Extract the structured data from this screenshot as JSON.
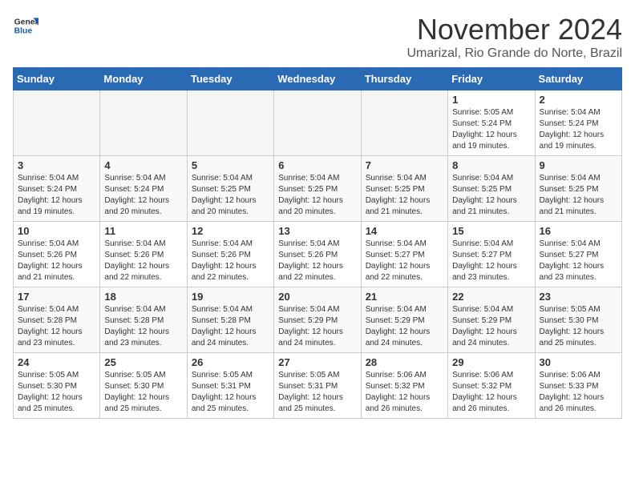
{
  "logo": {
    "line1": "General",
    "line2": "Blue"
  },
  "title": "November 2024",
  "location": "Umarizal, Rio Grande do Norte, Brazil",
  "weekdays": [
    "Sunday",
    "Monday",
    "Tuesday",
    "Wednesday",
    "Thursday",
    "Friday",
    "Saturday"
  ],
  "weeks": [
    [
      {
        "day": "",
        "info": ""
      },
      {
        "day": "",
        "info": ""
      },
      {
        "day": "",
        "info": ""
      },
      {
        "day": "",
        "info": ""
      },
      {
        "day": "",
        "info": ""
      },
      {
        "day": "1",
        "info": "Sunrise: 5:05 AM\nSunset: 5:24 PM\nDaylight: 12 hours and 19 minutes."
      },
      {
        "day": "2",
        "info": "Sunrise: 5:04 AM\nSunset: 5:24 PM\nDaylight: 12 hours and 19 minutes."
      }
    ],
    [
      {
        "day": "3",
        "info": "Sunrise: 5:04 AM\nSunset: 5:24 PM\nDaylight: 12 hours and 19 minutes."
      },
      {
        "day": "4",
        "info": "Sunrise: 5:04 AM\nSunset: 5:24 PM\nDaylight: 12 hours and 20 minutes."
      },
      {
        "day": "5",
        "info": "Sunrise: 5:04 AM\nSunset: 5:25 PM\nDaylight: 12 hours and 20 minutes."
      },
      {
        "day": "6",
        "info": "Sunrise: 5:04 AM\nSunset: 5:25 PM\nDaylight: 12 hours and 20 minutes."
      },
      {
        "day": "7",
        "info": "Sunrise: 5:04 AM\nSunset: 5:25 PM\nDaylight: 12 hours and 21 minutes."
      },
      {
        "day": "8",
        "info": "Sunrise: 5:04 AM\nSunset: 5:25 PM\nDaylight: 12 hours and 21 minutes."
      },
      {
        "day": "9",
        "info": "Sunrise: 5:04 AM\nSunset: 5:25 PM\nDaylight: 12 hours and 21 minutes."
      }
    ],
    [
      {
        "day": "10",
        "info": "Sunrise: 5:04 AM\nSunset: 5:26 PM\nDaylight: 12 hours and 21 minutes."
      },
      {
        "day": "11",
        "info": "Sunrise: 5:04 AM\nSunset: 5:26 PM\nDaylight: 12 hours and 22 minutes."
      },
      {
        "day": "12",
        "info": "Sunrise: 5:04 AM\nSunset: 5:26 PM\nDaylight: 12 hours and 22 minutes."
      },
      {
        "day": "13",
        "info": "Sunrise: 5:04 AM\nSunset: 5:26 PM\nDaylight: 12 hours and 22 minutes."
      },
      {
        "day": "14",
        "info": "Sunrise: 5:04 AM\nSunset: 5:27 PM\nDaylight: 12 hours and 22 minutes."
      },
      {
        "day": "15",
        "info": "Sunrise: 5:04 AM\nSunset: 5:27 PM\nDaylight: 12 hours and 23 minutes."
      },
      {
        "day": "16",
        "info": "Sunrise: 5:04 AM\nSunset: 5:27 PM\nDaylight: 12 hours and 23 minutes."
      }
    ],
    [
      {
        "day": "17",
        "info": "Sunrise: 5:04 AM\nSunset: 5:28 PM\nDaylight: 12 hours and 23 minutes."
      },
      {
        "day": "18",
        "info": "Sunrise: 5:04 AM\nSunset: 5:28 PM\nDaylight: 12 hours and 23 minutes."
      },
      {
        "day": "19",
        "info": "Sunrise: 5:04 AM\nSunset: 5:28 PM\nDaylight: 12 hours and 24 minutes."
      },
      {
        "day": "20",
        "info": "Sunrise: 5:04 AM\nSunset: 5:29 PM\nDaylight: 12 hours and 24 minutes."
      },
      {
        "day": "21",
        "info": "Sunrise: 5:04 AM\nSunset: 5:29 PM\nDaylight: 12 hours and 24 minutes."
      },
      {
        "day": "22",
        "info": "Sunrise: 5:04 AM\nSunset: 5:29 PM\nDaylight: 12 hours and 24 minutes."
      },
      {
        "day": "23",
        "info": "Sunrise: 5:05 AM\nSunset: 5:30 PM\nDaylight: 12 hours and 25 minutes."
      }
    ],
    [
      {
        "day": "24",
        "info": "Sunrise: 5:05 AM\nSunset: 5:30 PM\nDaylight: 12 hours and 25 minutes."
      },
      {
        "day": "25",
        "info": "Sunrise: 5:05 AM\nSunset: 5:30 PM\nDaylight: 12 hours and 25 minutes."
      },
      {
        "day": "26",
        "info": "Sunrise: 5:05 AM\nSunset: 5:31 PM\nDaylight: 12 hours and 25 minutes."
      },
      {
        "day": "27",
        "info": "Sunrise: 5:05 AM\nSunset: 5:31 PM\nDaylight: 12 hours and 25 minutes."
      },
      {
        "day": "28",
        "info": "Sunrise: 5:06 AM\nSunset: 5:32 PM\nDaylight: 12 hours and 26 minutes."
      },
      {
        "day": "29",
        "info": "Sunrise: 5:06 AM\nSunset: 5:32 PM\nDaylight: 12 hours and 26 minutes."
      },
      {
        "day": "30",
        "info": "Sunrise: 5:06 AM\nSunset: 5:33 PM\nDaylight: 12 hours and 26 minutes."
      }
    ]
  ]
}
